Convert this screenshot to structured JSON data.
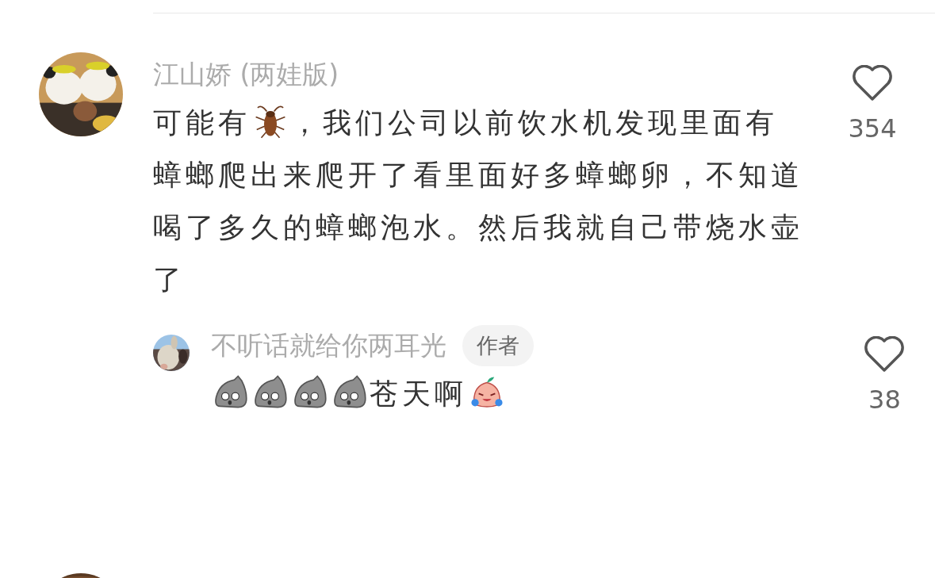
{
  "comments": [
    {
      "author": "江山娇 (两娃版)",
      "avatar": {
        "kind": "picture"
      },
      "body": [
        {
          "kind": "text",
          "text": "可能有"
        },
        {
          "kind": "bug"
        },
        {
          "kind": "text",
          "text": "，我们公司以前饮水机发现里面有蟑螂爬出来爬开了看里面好多蟑螂卵，不知道喝了多久的蟑螂泡水。然后我就自己带烧水壶了"
        }
      ],
      "likes": "354",
      "liked": false,
      "replies": [
        {
          "author": "不听话就给你两耳光",
          "badge": "作者",
          "avatar": {
            "kind": "picture"
          },
          "body": [
            {
              "kind": "stone"
            },
            {
              "kind": "stone"
            },
            {
              "kind": "stone"
            },
            {
              "kind": "stone"
            },
            {
              "kind": "text",
              "text": "苍天啊"
            },
            {
              "kind": "cry"
            }
          ],
          "likes": "38",
          "liked": false
        }
      ]
    },
    {
      "avatar": {
        "kind": "picture"
      }
    }
  ]
}
